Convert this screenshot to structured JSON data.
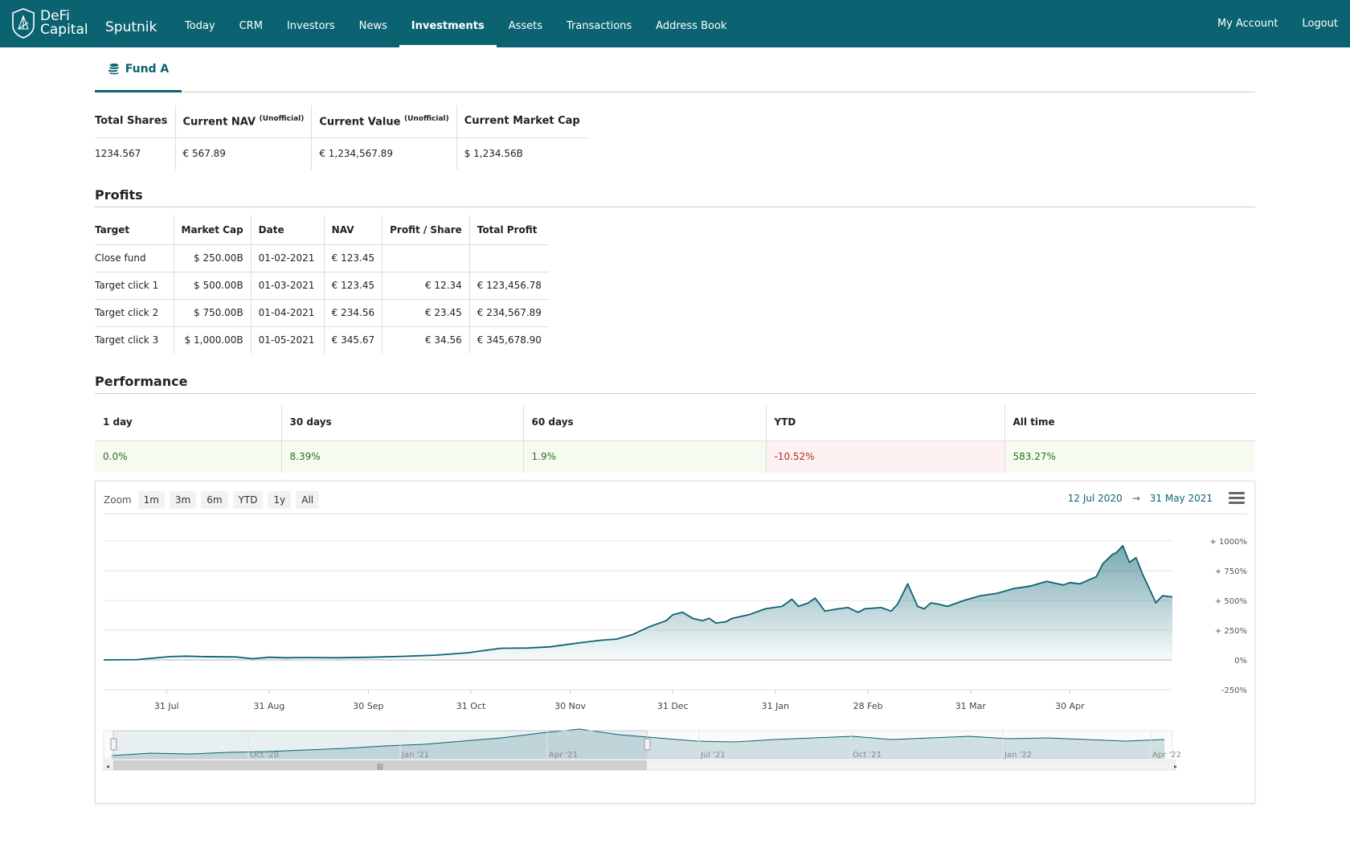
{
  "brand": {
    "line1": "DeFi",
    "line2": "Capital",
    "app": "Sputnik"
  },
  "nav": {
    "items": [
      {
        "label": "Today"
      },
      {
        "label": "CRM"
      },
      {
        "label": "Investors"
      },
      {
        "label": "News"
      },
      {
        "label": "Investments",
        "active": true
      },
      {
        "label": "Assets"
      },
      {
        "label": "Transactions"
      },
      {
        "label": "Address Book"
      }
    ],
    "right": [
      {
        "label": "My Account"
      },
      {
        "label": "Logout"
      }
    ]
  },
  "fund_tab": {
    "label": "Fund A",
    "icon": "coins-icon"
  },
  "summary": {
    "headers": [
      {
        "label": "Total Shares",
        "sup": ""
      },
      {
        "label": "Current NAV",
        "sup": "(Unofficial)"
      },
      {
        "label": "Current Value",
        "sup": "(Unofficial)"
      },
      {
        "label": "Current Market Cap",
        "sup": ""
      }
    ],
    "values": [
      "1234.567",
      "€ 567.89",
      "€ 1,234,567.89",
      "$ 1,234.56B"
    ]
  },
  "profits": {
    "title": "Profits",
    "headers": [
      "Target",
      "Market Cap",
      "Date",
      "NAV",
      "Profit / Share",
      "Total Profit"
    ],
    "rows": [
      [
        "Close fund",
        "$ 250.00B",
        "01-02-2021",
        "€ 123.45",
        "",
        ""
      ],
      [
        "Target click 1",
        "$ 500.00B",
        "01-03-2021",
        "€ 123.45",
        "€ 12.34",
        "€ 123,456.78"
      ],
      [
        "Target click 2",
        "$ 750.00B",
        "01-04-2021",
        "€ 234.56",
        "€ 23.45",
        "€ 234,567.89"
      ],
      [
        "Target click 3",
        "$ 1,000.00B",
        "01-05-2021",
        "€ 345.67",
        "€ 34.56",
        "€ 345,678.90"
      ]
    ]
  },
  "performance": {
    "title": "Performance",
    "headers": [
      "1 day",
      "30 days",
      "60 days",
      "YTD",
      "All time"
    ],
    "values": [
      "0.0%",
      "8.39%",
      "1.9%",
      "-10.52%",
      "583.27%"
    ],
    "signs": [
      "pos",
      "pos",
      "pos",
      "neg",
      "pos"
    ]
  },
  "chart_controls": {
    "zoom_label": "Zoom",
    "zoom_buttons": [
      "1m",
      "3m",
      "6m",
      "YTD",
      "1y",
      "All"
    ],
    "range_from": "12 Jul 2020",
    "range_arrow": "→",
    "range_to": "31 May 2021",
    "menu_icon": "hamburger-icon"
  },
  "chart_data": {
    "type": "area",
    "title": "",
    "xlabel": "",
    "ylabel": "",
    "color": "#0b6372",
    "y_ticks": [
      "+ 1000%",
      "+ 750%",
      "+ 500%",
      "+ 250%",
      "0%",
      "-250%"
    ],
    "y_tick_values": [
      1000,
      750,
      500,
      250,
      0,
      -250
    ],
    "ylim": [
      -250,
      1000
    ],
    "x_ticks": [
      "31 Jul",
      "31 Aug",
      "30 Sep",
      "31 Oct",
      "30 Nov",
      "31 Dec",
      "31 Jan",
      "28 Feb",
      "31 Mar",
      "30 Apr"
    ],
    "x_tick_days": [
      19,
      50,
      80,
      111,
      141,
      172,
      203,
      231,
      262,
      292
    ],
    "xlim_days": [
      0,
      323
    ],
    "series": [
      {
        "x_days": [
          0,
          10,
          20,
          25,
          30,
          40,
          45,
          50,
          55,
          60,
          70,
          80,
          90,
          100,
          110,
          120,
          128,
          135,
          140,
          145,
          150,
          155,
          160,
          165,
          170,
          172,
          175,
          178,
          181,
          183,
          185,
          188,
          190,
          195,
          200,
          205,
          208,
          210,
          213,
          215,
          218,
          222,
          225,
          228,
          230,
          235,
          238,
          240,
          243,
          246,
          248,
          250,
          252,
          255,
          258,
          260,
          265,
          270,
          275,
          280,
          285,
          290,
          292,
          295,
          300,
          302,
          305,
          306,
          308,
          310,
          312,
          314,
          316,
          318,
          320,
          323
        ],
        "values": [
          0,
          3,
          28,
          32,
          28,
          25,
          10,
          22,
          18,
          20,
          18,
          22,
          30,
          40,
          60,
          98,
          100,
          110,
          130,
          148,
          165,
          175,
          215,
          280,
          330,
          380,
          400,
          350,
          330,
          350,
          310,
          320,
          350,
          380,
          430,
          450,
          510,
          450,
          480,
          520,
          410,
          430,
          440,
          400,
          430,
          440,
          410,
          470,
          640,
          450,
          430,
          480,
          470,
          450,
          480,
          500,
          540,
          560,
          600,
          620,
          660,
          630,
          650,
          640,
          700,
          810,
          890,
          900,
          960,
          820,
          860,
          720,
          600,
          480,
          540,
          530
        ]
      }
    ],
    "navigator_ticks": [
      "Oct '20",
      "Jan '21",
      "Apr '21",
      "Jul '21",
      "Oct '21",
      "Jan '22",
      "Apr '22"
    ]
  }
}
